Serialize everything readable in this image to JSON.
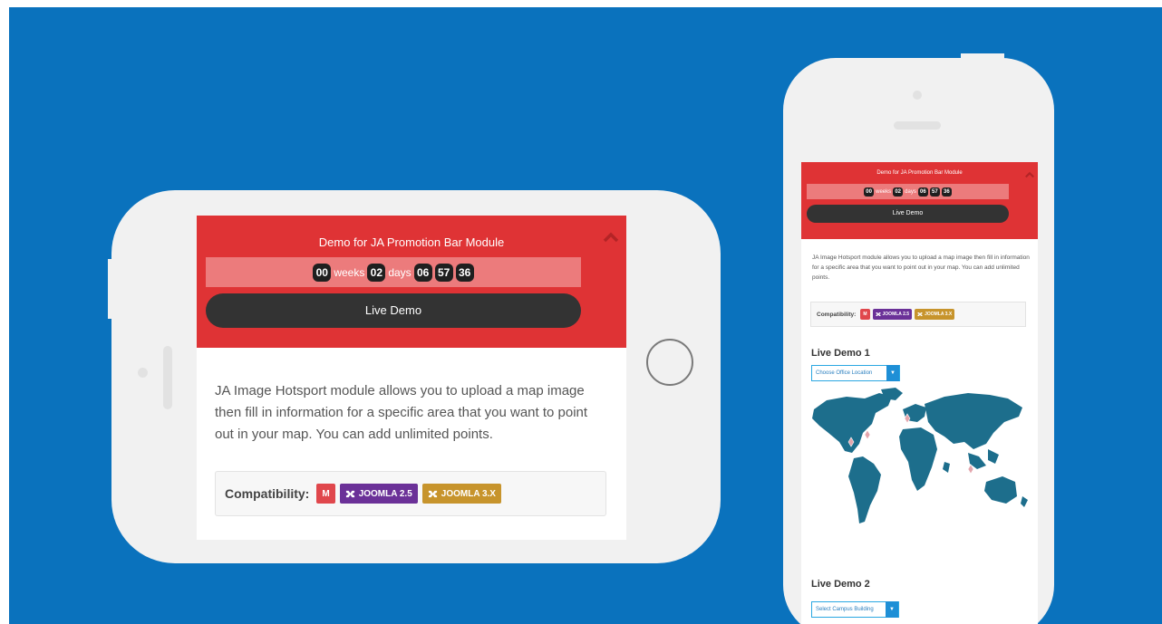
{
  "promo": {
    "title": "Demo for JA Promotion Bar Module",
    "weeks_value": "00",
    "weeks_label": "weeks",
    "days_value": "02",
    "days_label": "days",
    "hours": "06",
    "minutes": "57",
    "seconds": "36",
    "button_label": "Live Demo"
  },
  "description": "JA Image Hotsport module allows you to upload a map image then fill in information for a specific area that you want to point out in your map. You can add unlimited points.",
  "compatibility": {
    "label": "Compatibility:",
    "badges": [
      "M",
      "JOOMLA 2.5",
      "JOOMLA 3.X"
    ]
  },
  "live_demo_1": {
    "heading": "Live Demo 1",
    "dropdown_value": "Choose Office Location"
  },
  "live_demo_2": {
    "heading": "Live Demo 2",
    "dropdown_value": "Select Campus Building"
  },
  "colors": {
    "background": "#0a72bd",
    "promo_bar": "#df3335",
    "button": "#333333",
    "badge_m": "#e0474c",
    "badge_joomla25": "#6b3198",
    "badge_joomla3x": "#c7942c",
    "map": "#1d6e8c"
  },
  "icons": [
    "chevron-up-icon",
    "joomla-icon",
    "dropdown-arrow-icon"
  ]
}
